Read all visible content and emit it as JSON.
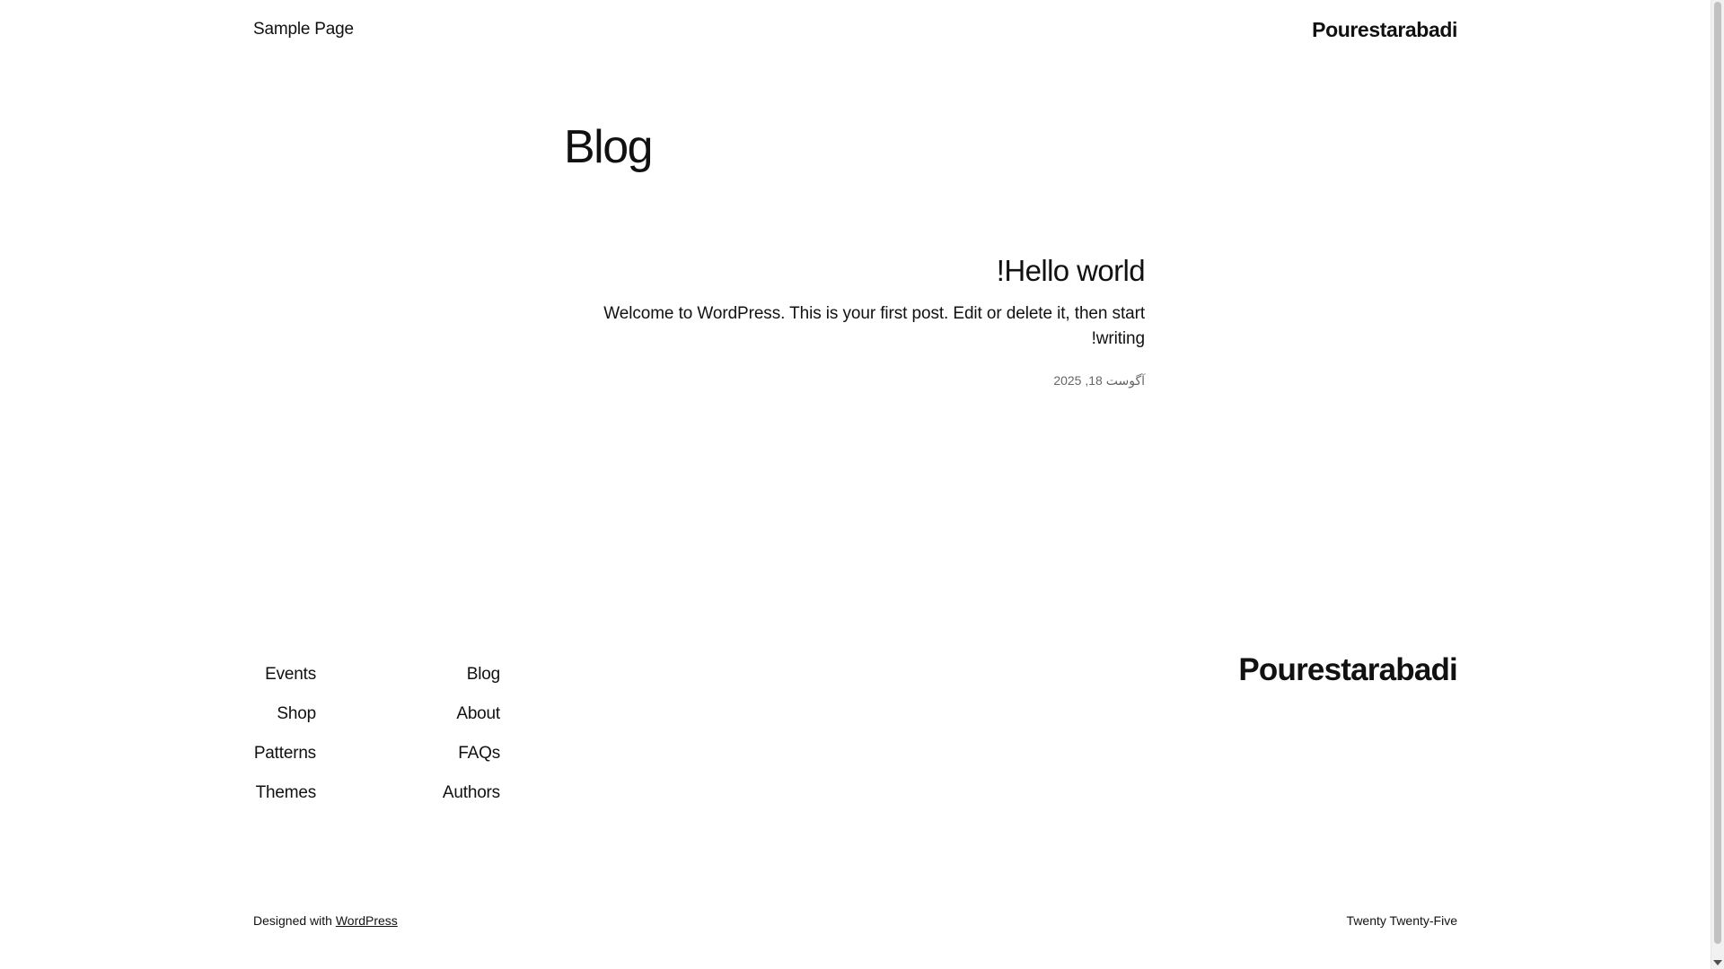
{
  "header": {
    "nav_item": "Sample Page",
    "site_title": "Pourestarabadi"
  },
  "main": {
    "heading": "Blog",
    "posts": [
      {
        "title": "Hello world!",
        "excerpt": "Welcome to WordPress. This is your first post. Edit or delete it, then start writing!",
        "date": "آگوست 18, 2025"
      }
    ]
  },
  "footer": {
    "site_title": "Pourestarabadi",
    "nav_primary": [
      "Blog",
      "About",
      "FAQs",
      "Authors"
    ],
    "nav_secondary": [
      "Events",
      "Shop",
      "Patterns",
      "Themes"
    ],
    "credits_prefix": "Designed with",
    "credits_link": "WordPress",
    "theme_name": "Twenty Twenty-Five"
  }
}
